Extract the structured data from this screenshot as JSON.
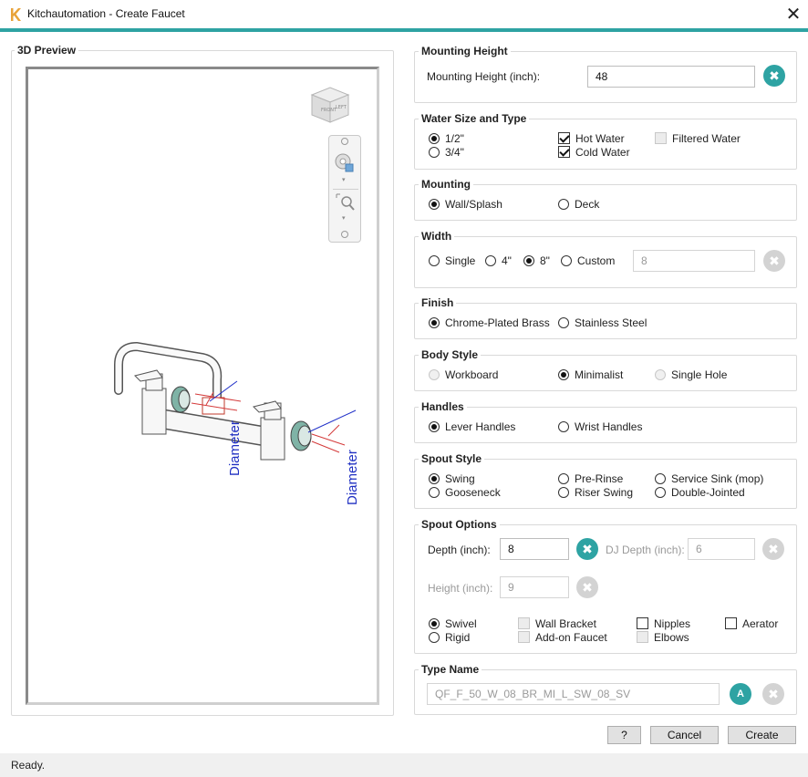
{
  "window": {
    "title": "Kitchautomation - Create Faucet",
    "close_glyph": "✕",
    "logo_icon": "k-logo-icon",
    "accent_color": "#2ea3a3"
  },
  "preview": {
    "title": "3D Preview",
    "viewcube_labels": [
      "FRONT",
      "LEFT"
    ],
    "dimension_labels": [
      "Diameter",
      "Diameter"
    ]
  },
  "mounting_height": {
    "title": "Mounting Height",
    "label": "Mounting Height (inch):",
    "value": "48",
    "clear_glyph": "✖"
  },
  "water": {
    "title": "Water Size and Type",
    "size_options": [
      "1/2\"",
      "3/4\""
    ],
    "size_selected": "1/2\"",
    "hot": "Hot Water",
    "cold": "Cold Water",
    "filtered": "Filtered Water",
    "hot_checked": true,
    "cold_checked": true,
    "filtered_checked": false
  },
  "mounting": {
    "title": "Mounting",
    "options": [
      "Wall/Splash",
      "Deck"
    ],
    "selected": "Wall/Splash"
  },
  "width": {
    "title": "Width",
    "options": [
      "Single",
      "4\"",
      "8\"",
      "Custom"
    ],
    "selected": "8\"",
    "custom_value": "8",
    "clear_glyph": "✖"
  },
  "finish": {
    "title": "Finish",
    "options": [
      "Chrome-Plated Brass",
      "Stainless Steel"
    ],
    "selected": "Chrome-Plated Brass"
  },
  "body_style": {
    "title": "Body Style",
    "options": [
      "Workboard",
      "Minimalist",
      "Single Hole"
    ],
    "selected": "Minimalist"
  },
  "handles": {
    "title": "Handles",
    "options": [
      "Lever Handles",
      "Wrist Handles"
    ],
    "selected": "Lever Handles"
  },
  "spout_style": {
    "title": "Spout Style",
    "options": [
      "Swing",
      "Gooseneck",
      "Pre-Rinse",
      "Riser Swing",
      "Service Sink (mop)",
      "Double-Jointed"
    ],
    "selected": "Swing"
  },
  "spout_options": {
    "title": "Spout Options",
    "depth_label": "Depth (inch):",
    "depth_value": "8",
    "dj_depth_label": "DJ Depth (inch):",
    "dj_depth_value": "6",
    "height_label": "Height (inch):",
    "height_value": "9",
    "swivel": "Swivel",
    "rigid": "Rigid",
    "wall_bracket": "Wall Bracket",
    "addon_faucet": "Add-on Faucet",
    "nipples": "Nipples",
    "elbows": "Elbows",
    "aerator": "Aerator",
    "swivel_selected": true,
    "clear_glyph": "✖"
  },
  "type_name": {
    "title": "Type Name",
    "value": "QF_F_50_W_08_BR_MI_L_SW_08_SV",
    "ai_label": "A",
    "clear_glyph": "✖"
  },
  "buttons": {
    "help": "?",
    "cancel": "Cancel",
    "create": "Create"
  },
  "status": "Ready."
}
